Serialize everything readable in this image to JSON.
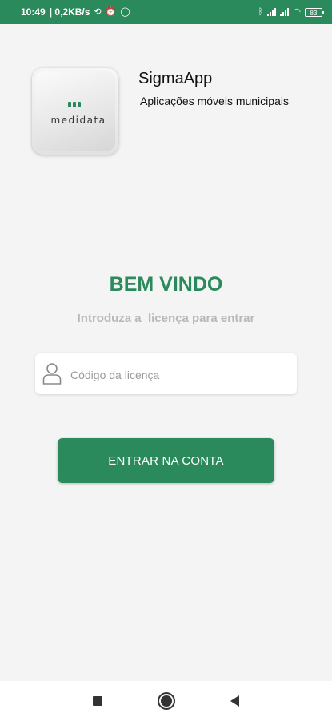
{
  "status_bar": {
    "time": "10:49",
    "speed": "| 0,2KB/s",
    "battery": "83",
    "icons_left": [
      "sync-off-icon",
      "alarm-icon",
      "whatsapp-icon"
    ],
    "icons_right": [
      "bluetooth-icon",
      "signal-icon",
      "signal-icon",
      "wifi-icon",
      "battery-icon"
    ]
  },
  "header": {
    "logo_text": "medidata",
    "app_title": "SigmaApp",
    "app_subtitle": "Aplicações móveis municipais"
  },
  "welcome": {
    "title": "BEM VINDO",
    "instruction": "Introduza a  licença para entrar"
  },
  "license_input": {
    "placeholder": "Código da licença",
    "value": ""
  },
  "enter_button": {
    "label": "ENTRAR NA CONTA"
  },
  "navbar": {
    "icons": [
      "recents-icon",
      "home-icon",
      "back-icon"
    ]
  },
  "colors": {
    "accent": "#2a8a5c",
    "background": "#f4f4f4",
    "muted_text": "#b8b8b8"
  }
}
